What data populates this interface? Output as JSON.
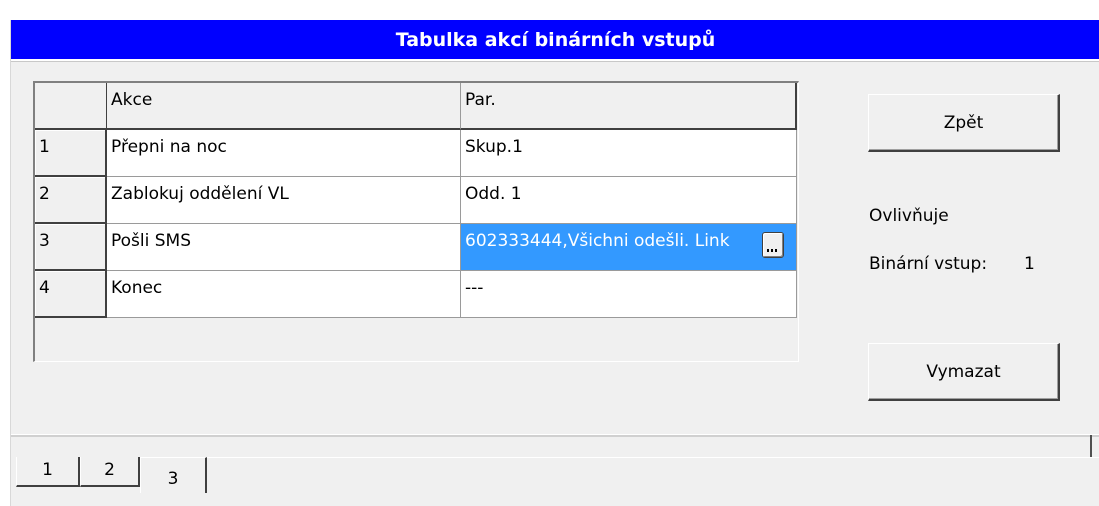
{
  "window": {
    "title": "Tabulka akcí binárních vstupů"
  },
  "table": {
    "headers": {
      "num": "",
      "akce": "Akce",
      "par": "Par."
    },
    "rows": [
      {
        "num": "1",
        "akce": "Přepni na noc",
        "par": "Skup.1"
      },
      {
        "num": "2",
        "akce": "Zablokuj oddělení VL",
        "par": "Odd. 1"
      },
      {
        "num": "3",
        "akce": "Pošli SMS",
        "par": "602333444,Všichni odešli. Link",
        "selected": true
      },
      {
        "num": "4",
        "akce": "Konec",
        "par": "---"
      }
    ]
  },
  "buttons": {
    "back": "Zpět",
    "delete": "Vymazat"
  },
  "info": {
    "affects_label": "Ovlivňuje",
    "binary_input_label": "Binární vstup:",
    "binary_input_value": "1"
  },
  "tabs": [
    {
      "label": "1"
    },
    {
      "label": "2"
    },
    {
      "label": "3",
      "active": true
    }
  ],
  "colors": {
    "titlebar": "#0000ff",
    "selection": "#3399ff",
    "window_bg": "#f0f0f0"
  }
}
